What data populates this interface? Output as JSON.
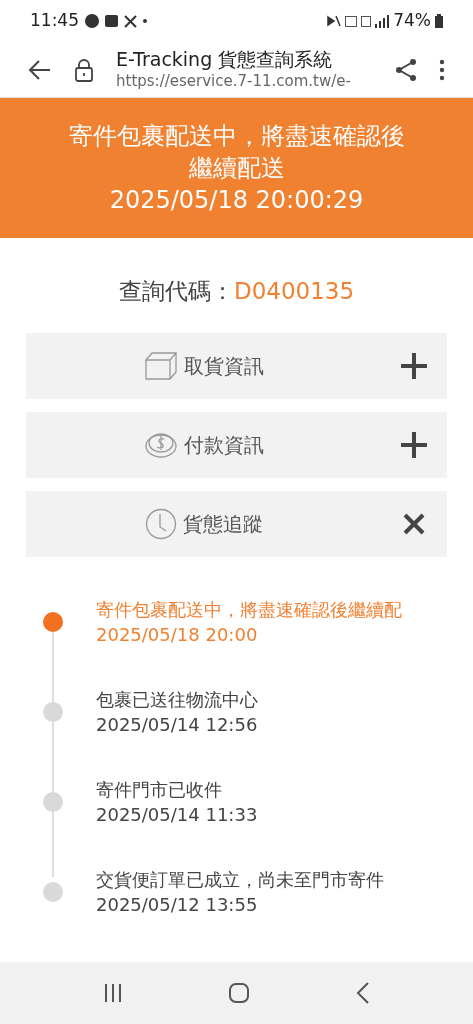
{
  "status_bar": {
    "time": "11:45",
    "battery": "74%"
  },
  "browser": {
    "title": "E-Tracking 貨態查詢系統",
    "url": "https://eservice.7-11.com.tw/e-"
  },
  "banner": {
    "status": "寄件包裹配送中，將盡速確認後繼續配送",
    "time": "2025/05/18 20:00:29"
  },
  "query": {
    "label": "查詢代碼：",
    "code": "D0400135"
  },
  "sections": [
    {
      "kind": "box",
      "label": "取貨資訊",
      "expanded": false
    },
    {
      "kind": "coin",
      "label": "付款資訊",
      "expanded": false
    },
    {
      "kind": "clock",
      "label": "貨態追蹤",
      "expanded": true
    }
  ],
  "timeline": [
    {
      "status": "寄件包裹配送中，將盡速確認後繼續配",
      "time": "2025/05/18 20:00",
      "current": true
    },
    {
      "status": "包裹已送往物流中心",
      "time": "2025/05/14 12:56",
      "current": false
    },
    {
      "status": "寄件門市已收件",
      "time": "2025/05/14 11:33",
      "current": false
    },
    {
      "status": "交貨便訂單已成立，尚未至門市寄件",
      "time": "2025/05/12 13:55",
      "current": false
    }
  ]
}
